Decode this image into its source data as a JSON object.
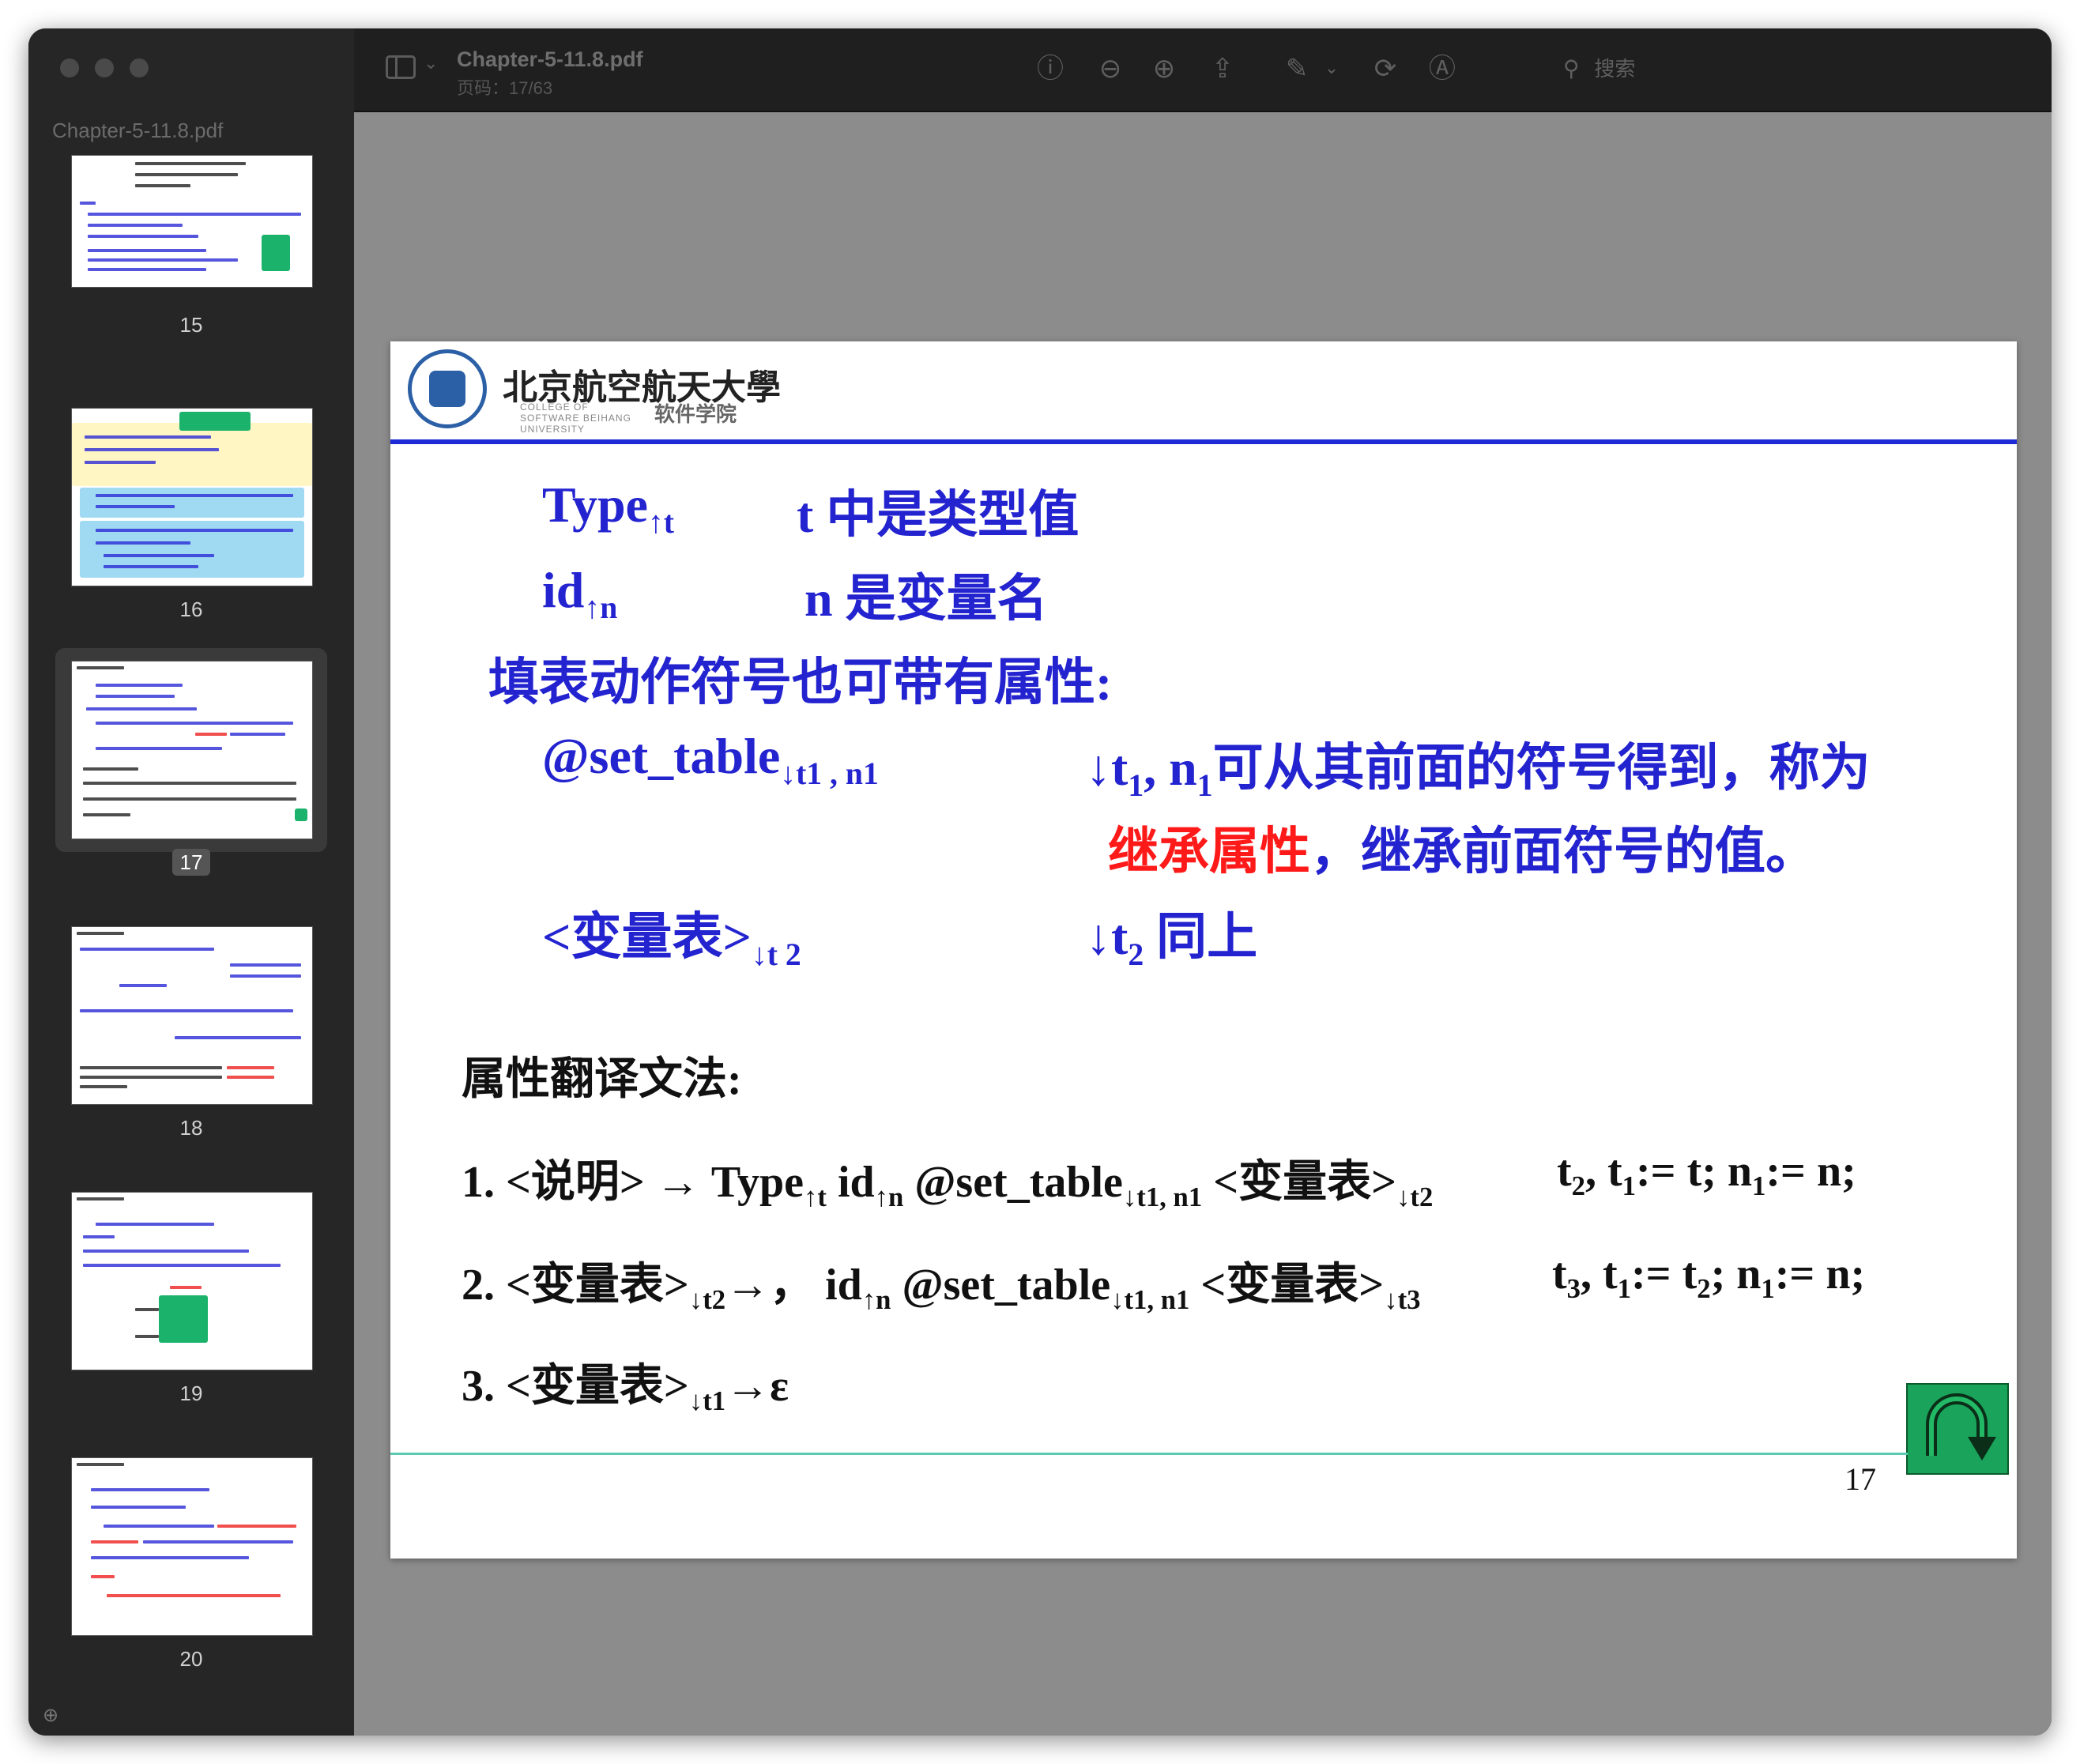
{
  "window": {
    "document_name": "Chapter-5-11.8.pdf",
    "page_info": "页码：17/63",
    "search_label": "搜索"
  },
  "sidebar": {
    "title": "Chapter-5-11.8.pdf",
    "thumbnails": [
      {
        "page": "15",
        "selected": false
      },
      {
        "page": "16",
        "selected": false
      },
      {
        "page": "17",
        "selected": true
      },
      {
        "page": "18",
        "selected": false
      },
      {
        "page": "19",
        "selected": false
      },
      {
        "page": "20",
        "selected": false
      }
    ]
  },
  "toolbar": {
    "icons": [
      "sidebar-toggle-icon",
      "info-icon",
      "zoom-out-icon",
      "zoom-in-icon",
      "share-icon",
      "markup-icon",
      "rotate-icon",
      "annotate-icon",
      "search-icon"
    ]
  },
  "slide": {
    "university": "北京航空航天大學",
    "college_en": "COLLEGE OF SOFTWARE BEIHANG UNIVERSITY",
    "college_cn": "软件学院",
    "l1_left": "Type",
    "l1_sub": "↑t",
    "l1_right": "t 中是类型值",
    "l2_left": "id",
    "l2_sub": "↑n",
    "l2_right": "n 是变量名",
    "l3": "填表动作符号也可带有属性:",
    "l4_left": "@set_table",
    "l4_sub": "↓t1 , n1",
    "l4_r1": "↓t",
    "l4_r1_sub": "1",
    "l4_r2": ", n",
    "l4_r2_sub": "1",
    "l4_r3": "可从其前面的符号得到，称为",
    "l5_red": "继承属性",
    "l5_rest": "，继承前面符号的值。",
    "l6_left": "<变量表>",
    "l6_sub": "↓t 2",
    "l6_r": "↓t",
    "l6_r_sub": "2",
    "l6_r_end": " 同上",
    "grammar_title": "属性翻译文法:",
    "rule1": {
      "a": "1. <说明> → Type",
      "a_sub": "↑t",
      "b": " id",
      "b_sub": "↑n",
      "c": " @set_table",
      "c_sub": "↓t1, n1",
      "d": " <变量表>",
      "d_sub": "↓t2",
      "e": "t",
      "e1": "2",
      "f": ", t",
      "f1": "1",
      "g": ":= t;   n",
      "g1": "1",
      "h": ":= n;"
    },
    "rule2": {
      "a": "2. <变量表>",
      "a_sub": "↓t2",
      "b": "→， id",
      "b_sub": "↑n",
      "c": " @set_table",
      "c_sub": "↓t1, n1",
      "d": " <变量表>",
      "d_sub": "↓t3",
      "e": "t",
      "e1": "3",
      "f": ", t",
      "f1": "1",
      "g": ":= t",
      "g1": "2",
      "h": ";  n",
      "h1": "1",
      "i": ":= n;"
    },
    "rule3": {
      "a": "3. <变量表>",
      "a_sub": "↓t1",
      "b": "→ε"
    },
    "page_number": "17"
  }
}
